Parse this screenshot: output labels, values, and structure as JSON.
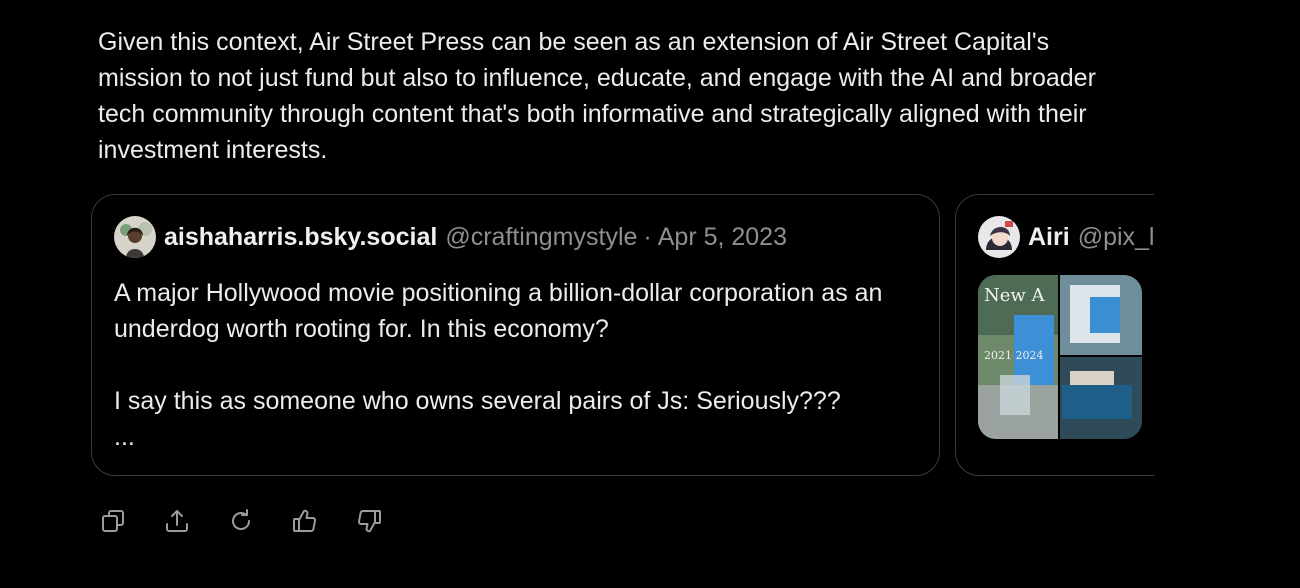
{
  "message": {
    "text": "Given this context, Air Street Press can be seen as an extension of Air Street Capital's mission to not just fund but also to influence, educate, and engage with the AI and broader tech community through content that's both informative and strategically aligned with their investment interests."
  },
  "cards": [
    {
      "display_name": "aishaharris.bsky.social",
      "handle": "@craftingmystyle",
      "separator": "·",
      "date": "Apr 5, 2023",
      "body": {
        "paragraph1": "A major Hollywood movie positioning a billion-dollar corporation as an underdog worth rooting for. In this economy?",
        "paragraph2": "I say this as someone who owns several pairs of Js: Seriously???",
        "ellipsis": "..."
      }
    },
    {
      "display_name": "Airi",
      "handle": "@pix_l",
      "media": {
        "thumb1_text": "New A",
        "thumb1_year": "2021 2024"
      }
    }
  ],
  "toolbar": [
    {
      "icon": "copy-icon"
    },
    {
      "icon": "share-icon"
    },
    {
      "icon": "regenerate-icon"
    },
    {
      "icon": "thumbs-up-icon"
    },
    {
      "icon": "thumbs-down-icon"
    }
  ]
}
